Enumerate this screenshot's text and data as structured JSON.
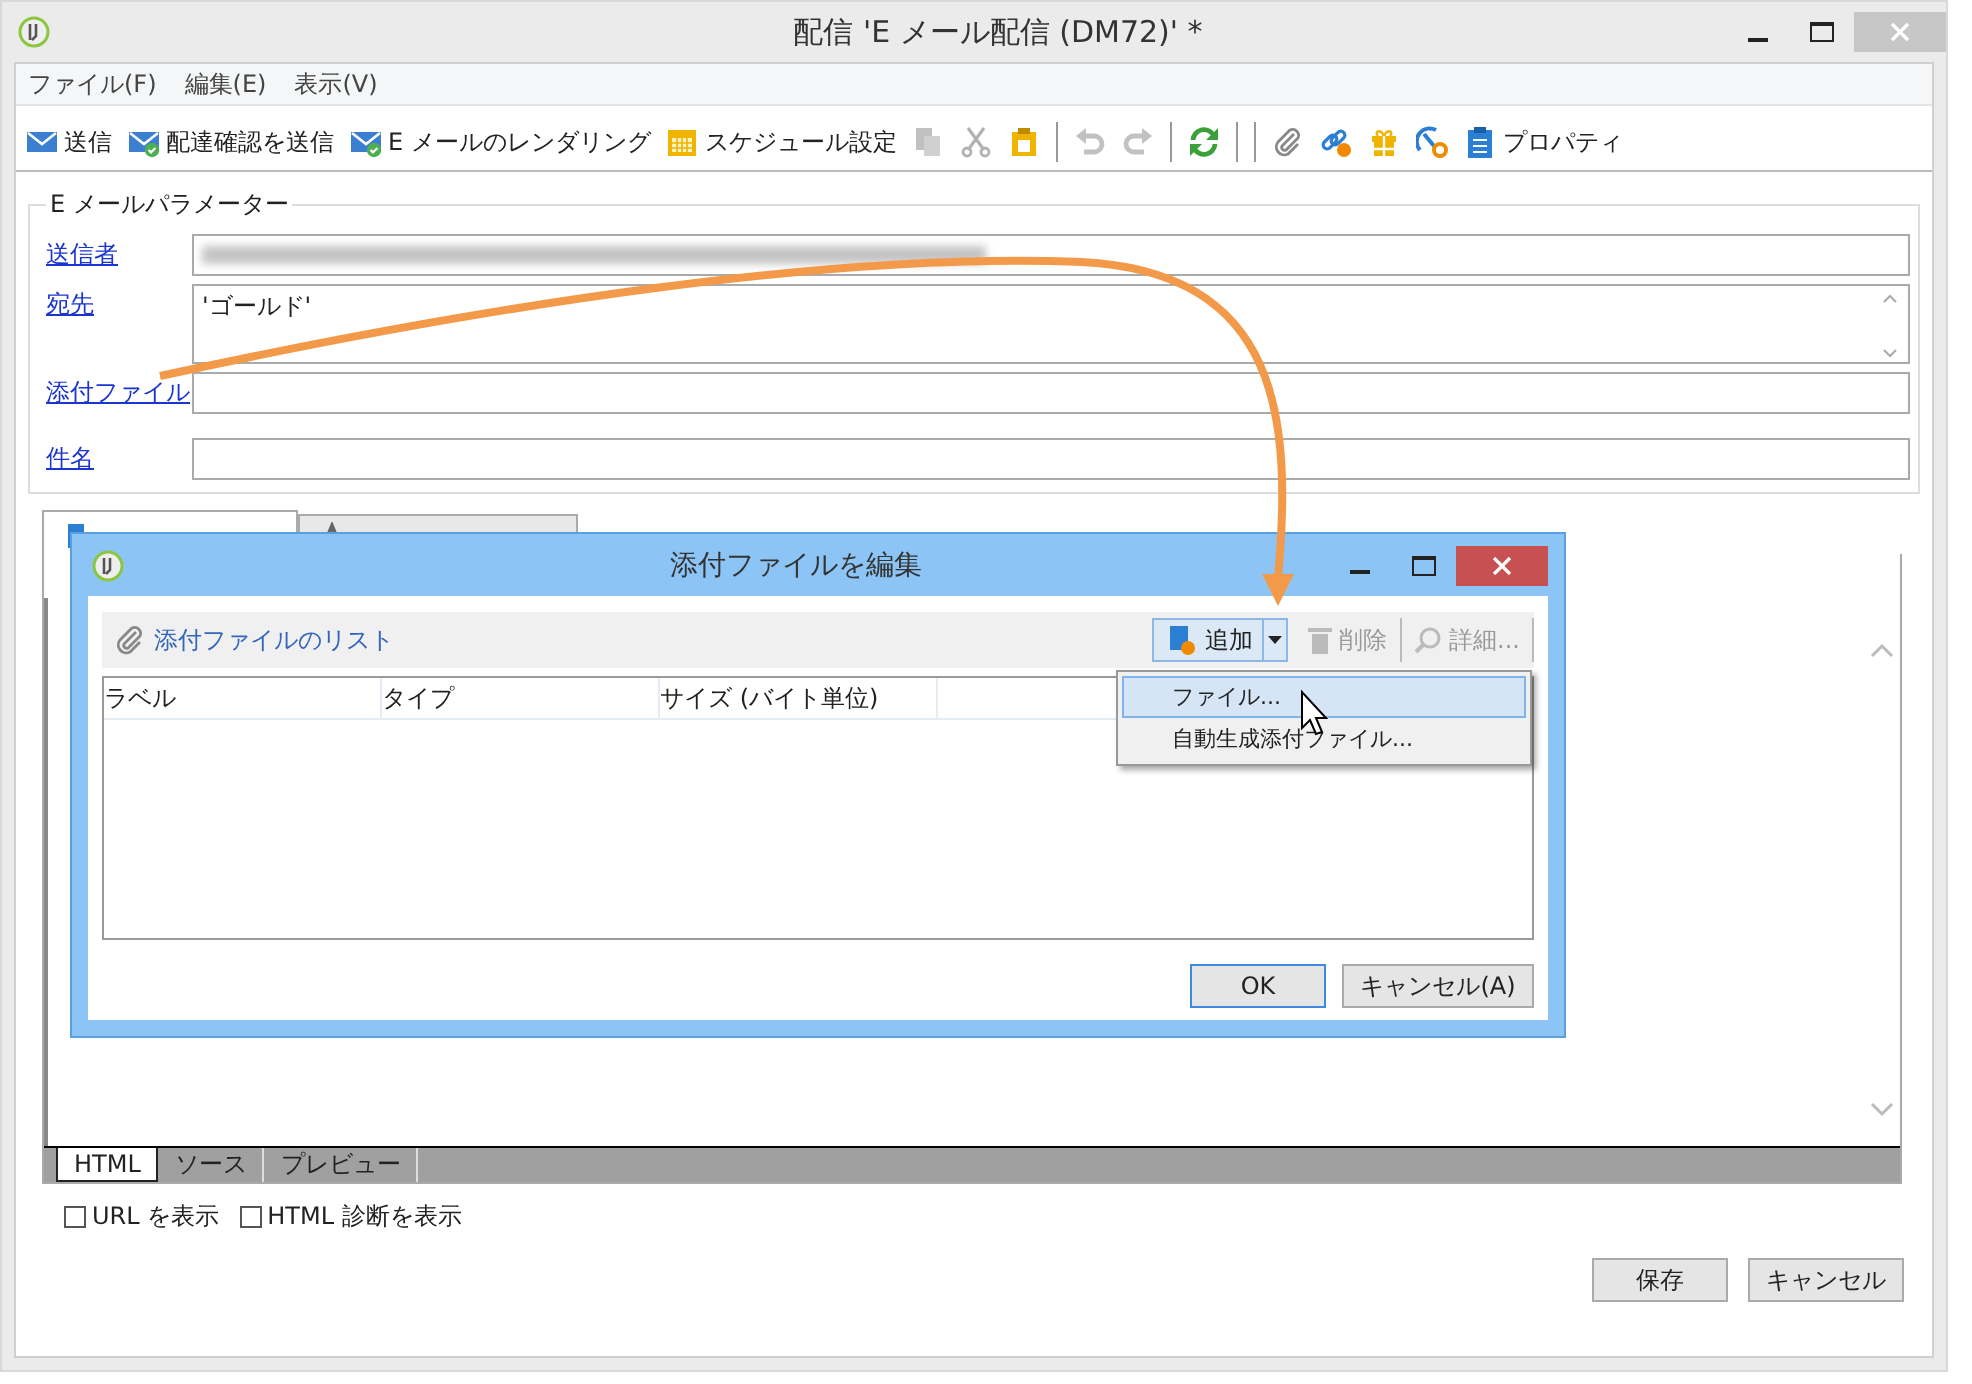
{
  "window": {
    "title": "配信 'E メール配信 (DM72)' *"
  },
  "menu": [
    "ファイル(F)",
    "編集(E)",
    "表示(V)"
  ],
  "toolbar": [
    {
      "kind": "text",
      "label": "送信",
      "disabled": false
    },
    {
      "kind": "text",
      "label": "配達確認を送信",
      "disabled": false
    },
    {
      "kind": "text",
      "label": "E メールのレンダリング",
      "disabled": false
    },
    {
      "kind": "text",
      "label": "スケジュール設定",
      "disabled": false
    },
    {
      "kind": "icon",
      "disabled": true
    },
    {
      "kind": "icon",
      "disabled": true
    },
    {
      "kind": "icon",
      "disabled": false
    },
    {
      "kind": "separator"
    },
    {
      "kind": "icon",
      "disabled": true
    },
    {
      "kind": "icon",
      "disabled": true
    },
    {
      "kind": "separator"
    },
    {
      "kind": "icon",
      "disabled": false
    },
    {
      "kind": "separator"
    },
    {
      "kind": "separator"
    },
    {
      "kind": "icon",
      "disabled": false
    },
    {
      "kind": "icon",
      "disabled": false
    },
    {
      "kind": "icon",
      "disabled": false
    },
    {
      "kind": "icon",
      "disabled": false
    },
    {
      "kind": "text",
      "label": "プロパティ",
      "disabled": false
    }
  ],
  "parameters": {
    "title": "E メールパラメーター",
    "fields": [
      {
        "label": "送信者",
        "kind": "blurred"
      },
      {
        "label": "宛先",
        "kind": "multiline",
        "value": "'ゴールド'"
      },
      {
        "label": "添付ファイル",
        "kind": "line"
      },
      {
        "label": "件名",
        "kind": "line"
      }
    ]
  },
  "content_tabs": [
    {
      "selected": true
    },
    {
      "selected": false
    }
  ],
  "editor_tabs": [
    {
      "label": "HTML",
      "selected": true
    },
    {
      "label": "ソース",
      "selected": false
    },
    {
      "label": "プレビュー",
      "selected": false
    }
  ],
  "options": [
    {
      "label": "URL を表示",
      "checked": false
    },
    {
      "label": "HTML 診断を表示",
      "checked": false
    }
  ],
  "buttons": [
    "保存",
    "キャンセル"
  ],
  "dialog": {
    "title": "添付ファイルを編集",
    "list_title": "添付ファイルのリスト",
    "actions": [
      {
        "label": "追加",
        "kind": "split",
        "disabled": false
      },
      {
        "label": "削除",
        "kind": "delete",
        "disabled": true
      },
      {
        "label": "詳細...",
        "kind": "details",
        "disabled": true
      }
    ],
    "columns": [
      "ラベル",
      "タイプ",
      "サイズ (バイト単位)"
    ],
    "buttons": [
      {
        "label": "OK",
        "default": true
      },
      {
        "label": "キャンセル(A)",
        "default": false
      }
    ],
    "menu": [
      {
        "label": "ファイル...",
        "selected": true
      },
      {
        "label": "自動生成添付ファイル...",
        "selected": false
      }
    ]
  }
}
